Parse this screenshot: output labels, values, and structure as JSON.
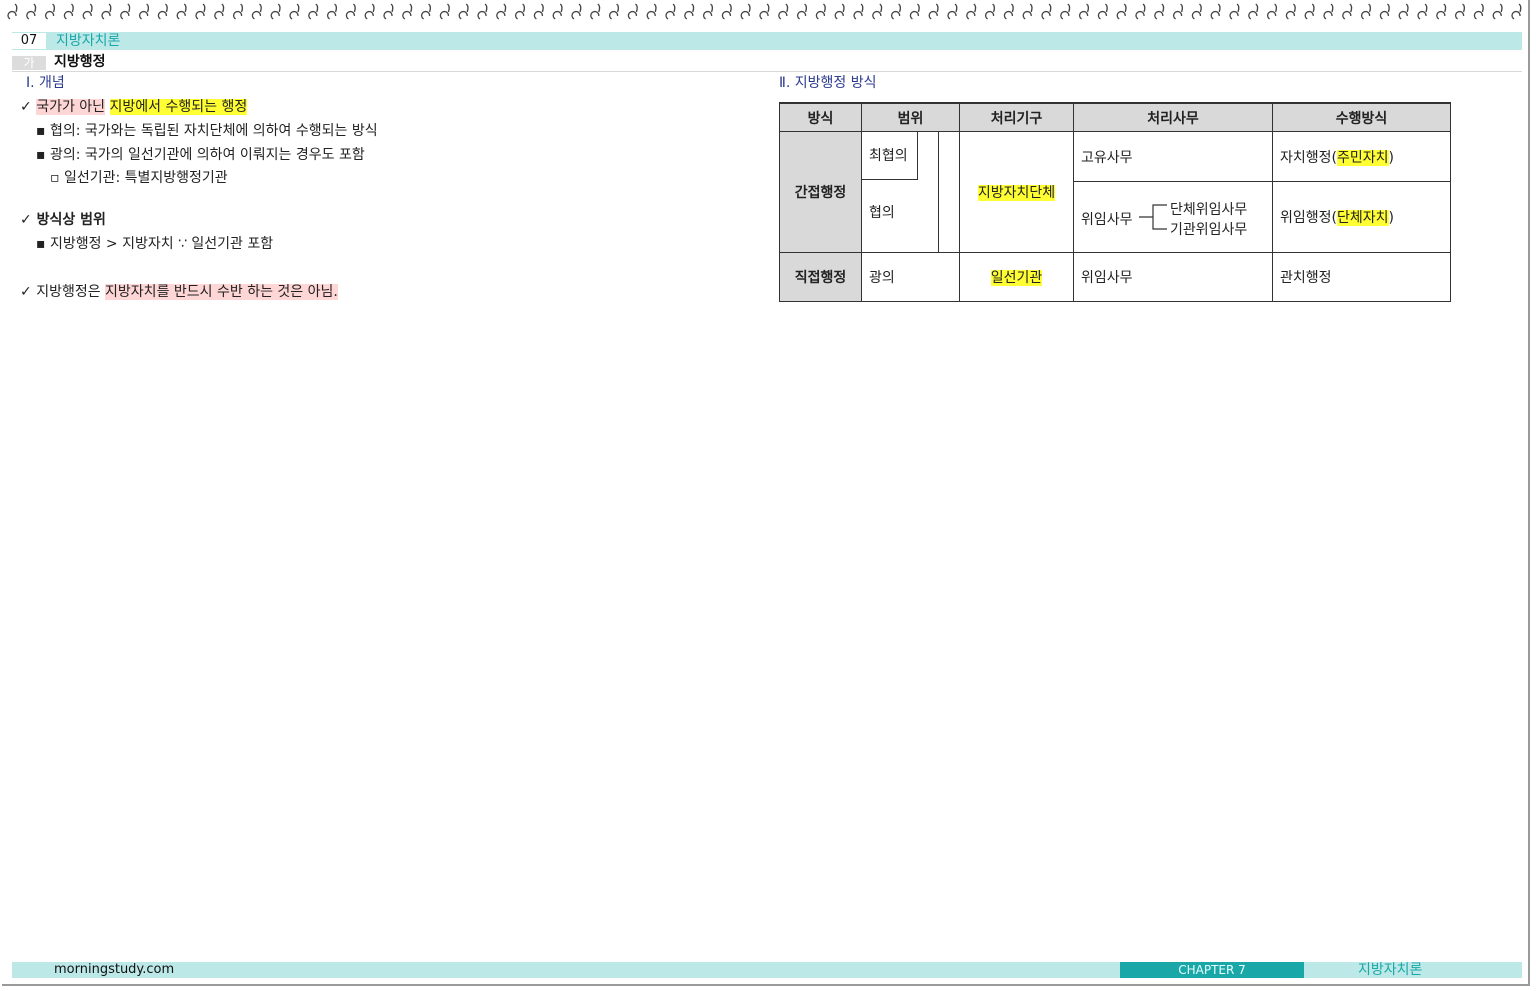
{
  "chapter": {
    "number": "07",
    "title": "지방자치론"
  },
  "section": {
    "tag": "가",
    "title": "지방행정"
  },
  "left": {
    "heading": "Ⅰ. 개념",
    "b1": {
      "check": "✓",
      "pre": "국가가 아닌",
      "highlight": "지방에서 수행되는 행정"
    },
    "b1_items": [
      "▪ 협의: 국가와는 독립된 자치단체에 의하여 수행되는 방식",
      "▪ 광의: 국가의 일선기관에 의하여 이뤄지는 경우도 포함",
      "▫ 일선기관: 특별지방행정기관"
    ],
    "b2": {
      "check": "✓",
      "text": "방식상 범위"
    },
    "b2_items": [
      "▪ 지방행정 > 지방자치   ∵ 일선기관 포함"
    ],
    "b3": {
      "check": "✓",
      "pre": "지방행정은",
      "highlight": "지방자치를 반드시 수반 하는 것은 아님."
    }
  },
  "right": {
    "heading": "Ⅱ. 지방행정 방식",
    "table": {
      "headers": [
        "방식",
        "범위",
        "처리기구",
        "처리사무",
        "수행방식"
      ],
      "indirect": "간접행정",
      "direct": "직접행정",
      "scope_narrowest": "최협의",
      "scope_narrow": "협의",
      "scope_broad": "광의",
      "agency_local": "지방자치단체",
      "agency_field": "일선기관",
      "own_affairs": "고유사무",
      "delegated": "위임사무",
      "delegated_group": "단체위임사무",
      "delegated_agency": "기관위임사무",
      "delegated_direct": "위임사무",
      "self_gov_pre": "자치행정(",
      "self_gov_hl": "주민자치",
      "self_gov_post": ")",
      "deleg_admin_pre": "위임행정(",
      "deleg_admin_hl": "단체자치",
      "deleg_admin_post": ")",
      "gov_admin": "관치행정"
    }
  },
  "footer": {
    "site": "morningstudy.com",
    "chapter": "CHAPTER 7",
    "title": "지방자치론"
  }
}
